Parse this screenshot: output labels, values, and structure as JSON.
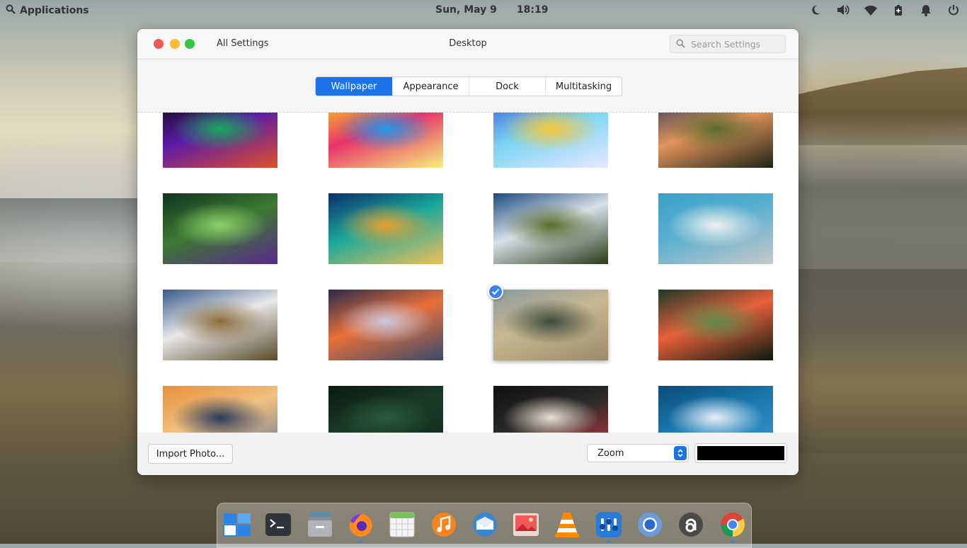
{
  "panel": {
    "applications_label": "Applications",
    "date": "Sun, May  9",
    "time": "18:19",
    "indicator_icons": [
      "night-light-icon",
      "volume-icon",
      "wifi-icon",
      "power-status-icon",
      "notifications-icon",
      "session-icon"
    ]
  },
  "window": {
    "back_label": "All Settings",
    "title": "Desktop",
    "search_placeholder": "Search Settings",
    "tabs": [
      {
        "label": "Wallpaper",
        "active": true
      },
      {
        "label": "Appearance",
        "active": false
      },
      {
        "label": "Dock",
        "active": false
      },
      {
        "label": "Multitasking",
        "active": false
      }
    ],
    "wallpapers": [
      {
        "icon": "abstract-rainbow-waves",
        "colors": [
          "#0b0b10",
          "#5b1aa8",
          "#1aa85b",
          "#e0502a"
        ]
      },
      {
        "icon": "hot-air-balloon",
        "colors": [
          "#f7d21a",
          "#e8336a",
          "#1e9be8",
          "#f5f07a"
        ]
      },
      {
        "icon": "whale-fish-clouds",
        "colors": [
          "#3a62d8",
          "#7ad4f0",
          "#f7c63a",
          "#e8e8ff"
        ]
      },
      {
        "icon": "grassland-sunset",
        "colors": [
          "#2c3a5c",
          "#e3935a",
          "#5a6a30",
          "#1c2418"
        ]
      },
      {
        "icon": "hummingbird",
        "colors": [
          "#10321f",
          "#3b7a30",
          "#8bd06a",
          "#5b2a8a"
        ]
      },
      {
        "icon": "aerial-beach",
        "colors": [
          "#0c2f6a",
          "#1aa89a",
          "#e8a030",
          "#f0c058"
        ]
      },
      {
        "icon": "aerial-mountains-forest",
        "colors": [
          "#1c4a80",
          "#d8e0e8",
          "#5a6a2a",
          "#2c3a18"
        ]
      },
      {
        "icon": "white-building",
        "colors": [
          "#3aa0c8",
          "#5ab0d0",
          "#f0f0f0",
          "#c8c8c8"
        ]
      },
      {
        "icon": "mountain-cliff",
        "colors": [
          "#3a5a8a",
          "#e8e8e8",
          "#8a6a3a",
          "#5a4a2a"
        ]
      },
      {
        "icon": "beach-sunset",
        "colors": [
          "#2a2a4a",
          "#e8703a",
          "#c8c8e0",
          "#3a4a6a"
        ]
      },
      {
        "icon": "misty-lake",
        "colors": [
          "#8a9aa0",
          "#c8b890",
          "#3a4a3a",
          "#9a8a6a"
        ],
        "selected": true
      },
      {
        "icon": "tulips",
        "colors": [
          "#1a3a2a",
          "#e8603a",
          "#5a8a4a",
          "#0a1a10"
        ]
      },
      {
        "icon": "mountain-sunset",
        "colors": [
          "#e8903a",
          "#f0c080",
          "#2a3a5a",
          "#6a7a9a"
        ]
      },
      {
        "icon": "fern-leaves",
        "colors": [
          "#0a1a12",
          "#1a3a28",
          "#2a5a3a",
          "#10281a"
        ]
      },
      {
        "icon": "paper-lantern",
        "colors": [
          "#101010",
          "#2a2a2a",
          "#e8e0d0",
          "#c83a3a"
        ]
      },
      {
        "icon": "aerial-ocean-waves",
        "colors": [
          "#0a4a7a",
          "#1a7ab0",
          "#e8f0f8",
          "#3a9ad0"
        ]
      }
    ],
    "import_label": "Import Photo...",
    "fill_mode": "Zoom",
    "background_color": "#000000"
  },
  "dock": {
    "items": [
      {
        "name": "multitasking-view-icon",
        "running": false
      },
      {
        "name": "terminal-icon",
        "running": false
      },
      {
        "name": "files-icon",
        "running": false
      },
      {
        "name": "firefox-icon",
        "running": true
      },
      {
        "name": "calendar-icon",
        "running": false
      },
      {
        "name": "music-icon",
        "running": false
      },
      {
        "name": "mail-icon",
        "running": false
      },
      {
        "name": "photos-icon",
        "running": false
      },
      {
        "name": "vlc-icon",
        "running": false
      },
      {
        "name": "settings-icon",
        "running": true
      },
      {
        "name": "chromium-icon",
        "running": false
      },
      {
        "name": "appcenter-icon",
        "running": false
      },
      {
        "name": "chrome-icon",
        "running": true
      }
    ]
  }
}
